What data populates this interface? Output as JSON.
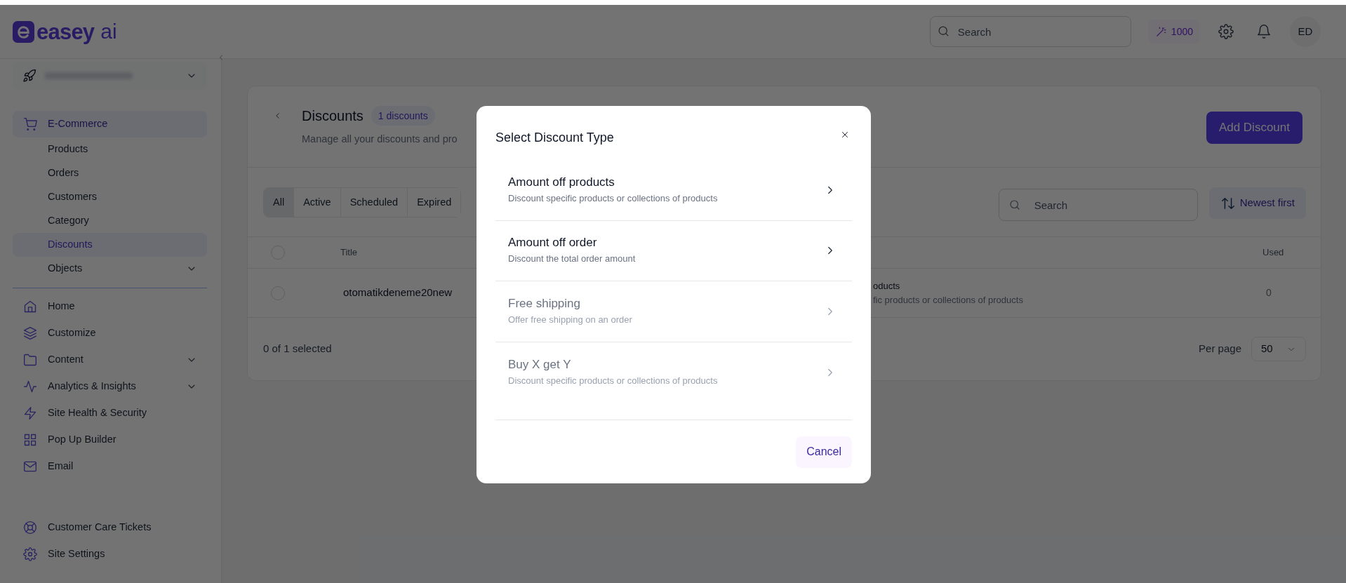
{
  "header": {
    "logo": {
      "word": "easey",
      "suffix": "ai"
    },
    "search": {
      "placeholder": "Search"
    },
    "credits": "1000",
    "avatar": "ED"
  },
  "sidebar": {
    "sections": [
      {
        "items": [
          {
            "label": "E-Commerce",
            "selected": true,
            "has_chevron": false,
            "children": [
              {
                "label": "Products",
                "selected": false,
                "has_chevron": false
              },
              {
                "label": "Orders",
                "selected": false,
                "has_chevron": false
              },
              {
                "label": "Customers",
                "selected": false,
                "has_chevron": false
              },
              {
                "label": "Category",
                "selected": false,
                "has_chevron": false
              },
              {
                "label": "Discounts",
                "selected": true,
                "has_chevron": false
              },
              {
                "label": "Objects",
                "selected": false,
                "has_chevron": true
              }
            ]
          }
        ]
      },
      {
        "items": [
          {
            "label": "Home",
            "selected": false,
            "has_chevron": false
          },
          {
            "label": "Customize",
            "selected": false,
            "has_chevron": false
          },
          {
            "label": "Content",
            "selected": false,
            "has_chevron": true
          },
          {
            "label": "Analytics & Insights",
            "selected": false,
            "has_chevron": true
          },
          {
            "label": "Site Health & Security",
            "selected": false,
            "has_chevron": false
          },
          {
            "label": "Pop Up Builder",
            "selected": false,
            "has_chevron": false
          },
          {
            "label": "Email",
            "selected": false,
            "has_chevron": false
          }
        ]
      },
      {
        "items": [
          {
            "label": "Customer Care Tickets",
            "selected": false,
            "has_chevron": false
          },
          {
            "label": "Site Settings",
            "selected": false,
            "has_chevron": false
          }
        ]
      }
    ]
  },
  "page": {
    "title": "Discounts",
    "count_badge": "1 discounts",
    "subtitle": "Manage all your discounts and pro",
    "add_button": "Add Discount",
    "filter_tabs": [
      {
        "label": "All",
        "selected": true
      },
      {
        "label": "Active",
        "selected": false
      },
      {
        "label": "Scheduled",
        "selected": false
      },
      {
        "label": "Expired",
        "selected": false
      }
    ],
    "search": {
      "placeholder": "Search"
    },
    "sort_button": "Newest first",
    "table": {
      "header_checked": false,
      "columns": [
        "Title",
        "Used"
      ],
      "rows": [
        {
          "checked": false,
          "title": "otomatikdeneme20new",
          "column_3": [
            "oducts",
            "fic products or collections of products"
          ],
          "used": "0"
        }
      ]
    },
    "selection_summary": "0 of 1 selected",
    "per_page_label": "Per page",
    "per_page_value": "50"
  },
  "modal": {
    "title": "Select Discount Type",
    "options": [
      {
        "title": "Amount off products",
        "description": "Discount specific products or collections of products",
        "disabled": false
      },
      {
        "title": "Amount off order",
        "description": "Discount the total order amount",
        "disabled": false
      },
      {
        "title": "Free shipping",
        "description": "Offer free shipping on an order",
        "disabled": true
      },
      {
        "title": "Buy X get Y",
        "description": "Discount specific products or collections of products",
        "disabled": true
      }
    ],
    "cancel_button": "Cancel"
  }
}
